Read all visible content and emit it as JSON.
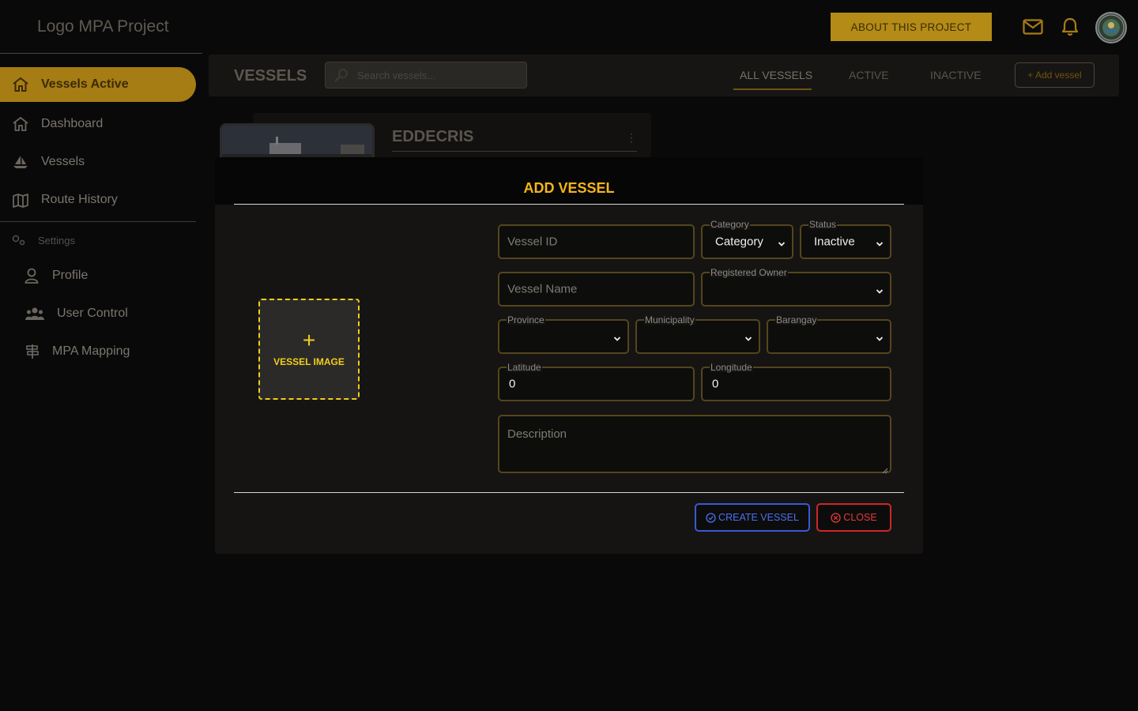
{
  "app": {
    "logo_text": "Logo MPA Project",
    "about_label": "ABOUT THIS PROJECT"
  },
  "topbar_icons": [
    "mail-icon",
    "bell-icon"
  ],
  "sidebar": {
    "active_item": "Vessels Active",
    "items": [
      {
        "label": "Dashboard",
        "icon": "home-icon"
      },
      {
        "label": "Vessels",
        "icon": "sailboat-icon"
      },
      {
        "label": "Route History",
        "icon": "map-icon"
      }
    ],
    "settings_label": "Settings",
    "settings_items": [
      {
        "label": "Profile",
        "icon": "user-icon"
      },
      {
        "label": "User Control",
        "icon": "users-icon"
      },
      {
        "label": "MPA Mapping",
        "icon": "signpost-icon"
      }
    ]
  },
  "header": {
    "title": "VESSELS",
    "search_placeholder": "Search vessels...",
    "tabs": [
      "ALL VESSELS",
      "ACTIVE",
      "INACTIVE"
    ],
    "active_tab": "ALL VESSELS",
    "add_label": "+ Add vessel"
  },
  "card": {
    "vessel_name": "EDDECRIS"
  },
  "modal": {
    "title": "ADD VESSEL",
    "image_label": "VESSEL IMAGE",
    "fields": {
      "vessel_id_placeholder": "Vessel ID",
      "category_label": "Category",
      "category_value": "Category",
      "status_label": "Status",
      "status_value": "Inactive",
      "vessel_name_placeholder": "Vessel Name",
      "registered_owner_label": "Registered Owner",
      "province_label": "Province",
      "municipality_label": "Municipality",
      "barangay_label": "Barangay",
      "latitude_label": "Latitude",
      "latitude_value": "0",
      "longitude_label": "Longitude",
      "longitude_value": "0",
      "description_placeholder": "Description"
    },
    "create_label": "CREATE VESSEL",
    "close_label": "CLOSE"
  },
  "colors": {
    "accent": "#f4b51a",
    "active_nav": "#a67c14",
    "create_blue": "#4f6fef",
    "close_red": "#e23a3a",
    "dashed_yellow": "#f1cd1c"
  }
}
